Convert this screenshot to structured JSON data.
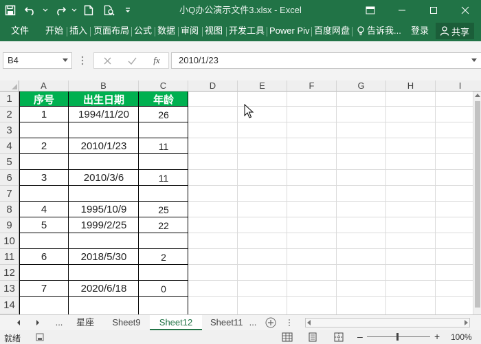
{
  "window": {
    "title": "小Q办公演示文件3.xlsx  -  Excel"
  },
  "ribbon": {
    "tabs": [
      "文件",
      "开始",
      "插入",
      "页面布局",
      "公式",
      "数据",
      "审阅",
      "视图",
      "开发工具",
      "Power Piv",
      "百度网盘"
    ],
    "tell_me": "告诉我...",
    "login": "登录",
    "share": "共享"
  },
  "formula_bar": {
    "name_box": "B4",
    "fx_label": "fx",
    "value": "2010/1/23"
  },
  "grid": {
    "columns": [
      "A",
      "B",
      "C",
      "D",
      "E",
      "F",
      "G",
      "H",
      "I"
    ],
    "rows": [
      "1",
      "2",
      "3",
      "4",
      "5",
      "6",
      "7",
      "8",
      "9",
      "10",
      "11",
      "12",
      "13",
      "14"
    ],
    "table": {
      "headers": [
        "序号",
        "出生日期",
        "年龄"
      ],
      "rows": [
        [
          "1",
          "1994/11/20",
          "26"
        ],
        [
          "",
          "",
          ""
        ],
        [
          "2",
          "2010/1/23",
          "11"
        ],
        [
          "",
          "",
          ""
        ],
        [
          "3",
          "2010/3/6",
          "11"
        ],
        [
          "",
          "",
          ""
        ],
        [
          "4",
          "1995/10/9",
          "25"
        ],
        [
          "5",
          "1999/2/25",
          "22"
        ],
        [
          "",
          "",
          ""
        ],
        [
          "6",
          "2018/5/30",
          "2"
        ],
        [
          "",
          "",
          ""
        ],
        [
          "7",
          "2020/6/18",
          "0"
        ],
        [
          "",
          "",
          ""
        ]
      ]
    }
  },
  "sheet_tabs": {
    "ellipsis": "...",
    "tabs": [
      "星座",
      "Sheet9",
      "Sheet12",
      "Sheet11"
    ],
    "active": "Sheet12",
    "more": "..."
  },
  "status_bar": {
    "status": "就绪",
    "zoom": "100%"
  },
  "colors": {
    "excel_green": "#217346",
    "header_fill": "#00b050"
  }
}
